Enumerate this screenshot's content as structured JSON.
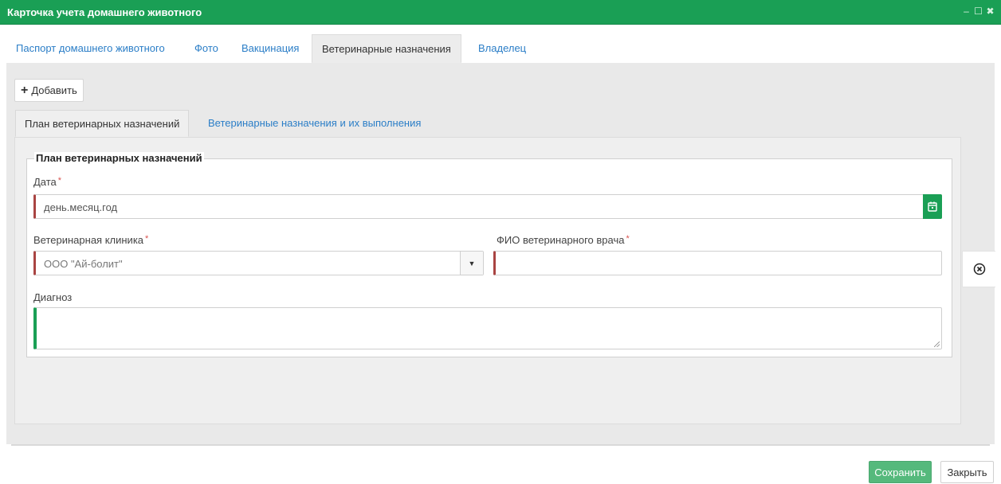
{
  "window": {
    "title": "Карточка учета домашнего животного",
    "accent_color": "#1a9f55",
    "controls": {
      "minimize": "–",
      "maximize": "☐",
      "close": "✖"
    }
  },
  "tabs": [
    {
      "label": "Паспорт домашнего животного",
      "active": false
    },
    {
      "label": "Фото",
      "active": false
    },
    {
      "label": "Вакцинация",
      "active": false
    },
    {
      "label": "Ветеринарные назначения",
      "active": true
    },
    {
      "label": "Владелец",
      "active": false
    }
  ],
  "toolbar": {
    "add_label": "Добавить",
    "add_icon": "plus-icon"
  },
  "subtabs": [
    {
      "label": "План ветеринарных назначений",
      "active": true
    },
    {
      "label": "Ветеринарные назначения и их выполнения",
      "active": false
    }
  ],
  "form": {
    "legend": "План ветеринарных назначений",
    "required_mark": "*",
    "date": {
      "label": "Дата",
      "placeholder": "день.месяц.год",
      "icon": "calendar-icon",
      "required": true
    },
    "clinic": {
      "label": "Ветеринарная клиника",
      "value": "ООО \"Ай-болит\"",
      "icon": "caret-down-icon",
      "required": true
    },
    "vet_name": {
      "label": "ФИО ветеринарного врача",
      "value": "",
      "required": true
    },
    "diagnosis": {
      "label": "Диагноз",
      "value": ""
    }
  },
  "side": {
    "remove_icon": "circle-x-icon"
  },
  "footer": {
    "save_label": "Сохранить",
    "close_label": "Закрыть"
  }
}
